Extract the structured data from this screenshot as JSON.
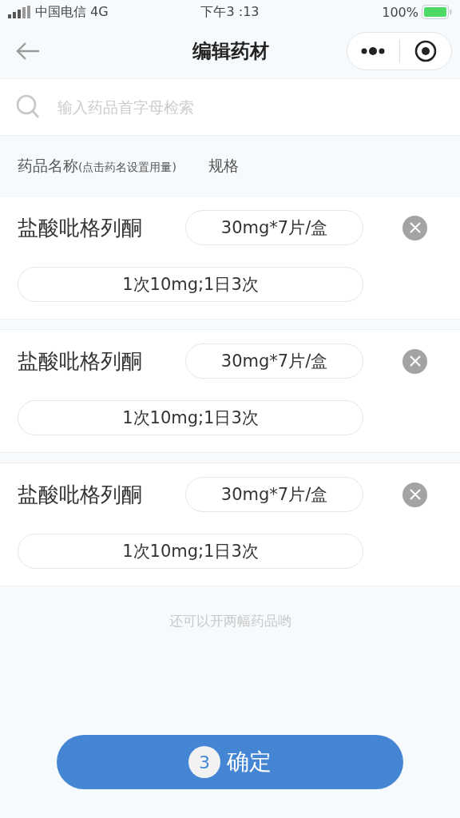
{
  "status_bar": {
    "carrier": "中国电信 4G",
    "time": "下午3 :13",
    "battery": "100%"
  },
  "nav": {
    "title": "编辑药材"
  },
  "search": {
    "placeholder": "输入药品首字母检索"
  },
  "columns": {
    "name": "药品名称",
    "name_hint": "(点击药名设置用量)",
    "spec": "规格"
  },
  "medicines": [
    {
      "name": "盐酸吡格列酮",
      "spec": "30mg*7片/盒",
      "dosage": "1次10mg;1日3次"
    },
    {
      "name": "盐酸吡格列酮",
      "spec": "30mg*7片/盒",
      "dosage": "1次10mg;1日3次"
    },
    {
      "name": "盐酸吡格列酮",
      "spec": "30mg*7片/盒",
      "dosage": "1次10mg;1日3次"
    }
  ],
  "note": "还可以开两幅药品哟",
  "confirm": {
    "count": "3",
    "label": "确定"
  }
}
